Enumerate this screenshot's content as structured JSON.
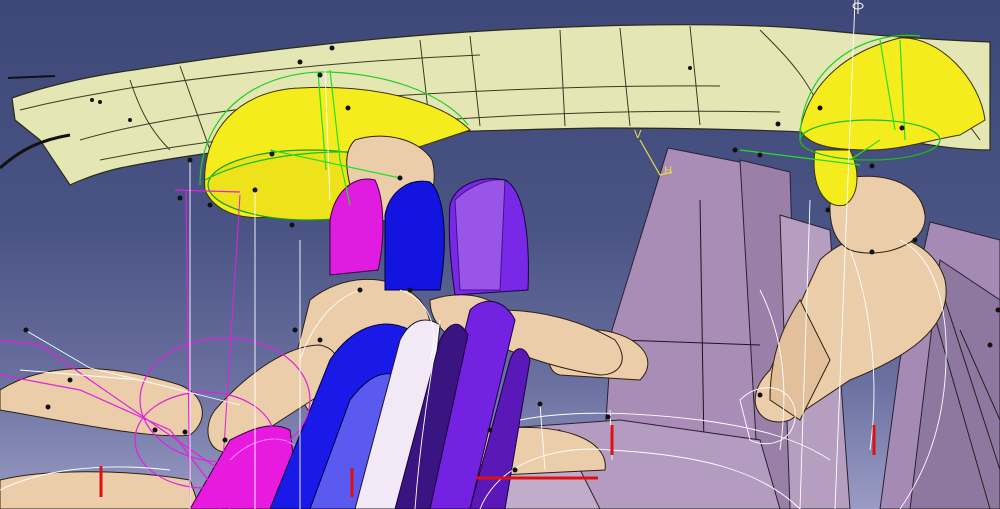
{
  "scene": {
    "kind": "3d-cad-viewport",
    "compass": {
      "v_label": "V",
      "h_label": "H"
    },
    "colors": {
      "background_top": "#3e4878",
      "background_bottom": "#9a9cc4",
      "roof_panel": "#e4e6b4",
      "airbag_yellow": "#f4ec1c",
      "manikin_skin": "#eccdaa",
      "seat_magenta": "#e01ce0",
      "seat_blue": "#1414e0",
      "seat_violet": "#7a28e8",
      "seat_back_lilac": "#a88cb4",
      "construction_lines": "#ffffff",
      "markers_red": "#e01010",
      "green_sketch": "#20e020"
    }
  }
}
